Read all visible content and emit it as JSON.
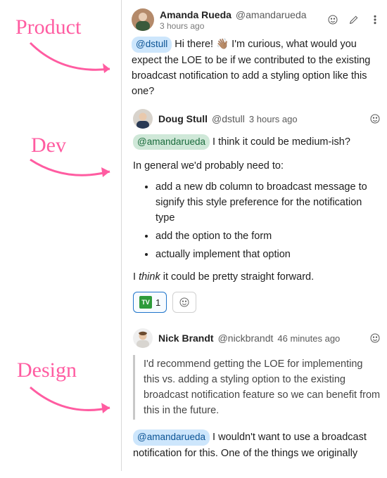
{
  "labels": {
    "product": "Product",
    "dev": "Dev",
    "design": "Design"
  },
  "thread": {
    "root": {
      "author": {
        "name": "Amanda Rueda",
        "handle": "@amandarueda"
      },
      "time": "3 hours ago",
      "mention": "@dstull",
      "wave": "👋🏽",
      "body_after": " Hi there! ",
      "body_tail": " I'm curious, what would you expect the LOE to be if we contributed to the existing broadcast notification to add a styling option like this one?"
    },
    "reply1": {
      "author": {
        "name": "Doug Stull",
        "handle": "@dstull"
      },
      "time": "3 hours ago",
      "mention": "@amandarueda",
      "line1_tail": " I think it could be medium-ish?",
      "para2": "In general we'd probably need to:",
      "bullets": [
        "add a new db column to broadcast message to signify this style preference for the notification type",
        "add the option to the form",
        "actually implement that option"
      ],
      "closing_pre": "I ",
      "closing_italic": "think",
      "closing_post": " it could be pretty straight forward.",
      "reaction_count": "1",
      "reaction_icon": "TV"
    },
    "reply2": {
      "author": {
        "name": "Nick Brandt",
        "handle": "@nickbrandt"
      },
      "time": "46 minutes ago",
      "quote": "I'd recommend getting the LOE for implementing this vs. adding a styling option to the existing broadcast notification feature so we can benefit from this in the future.",
      "mention": "@amandarueda",
      "body_tail": " I wouldn't want to use a broadcast notification for this. One of the things we originally"
    }
  },
  "icons": {
    "smile": "smile-icon",
    "pencil": "pencil-icon",
    "kebab": "more-icon"
  }
}
